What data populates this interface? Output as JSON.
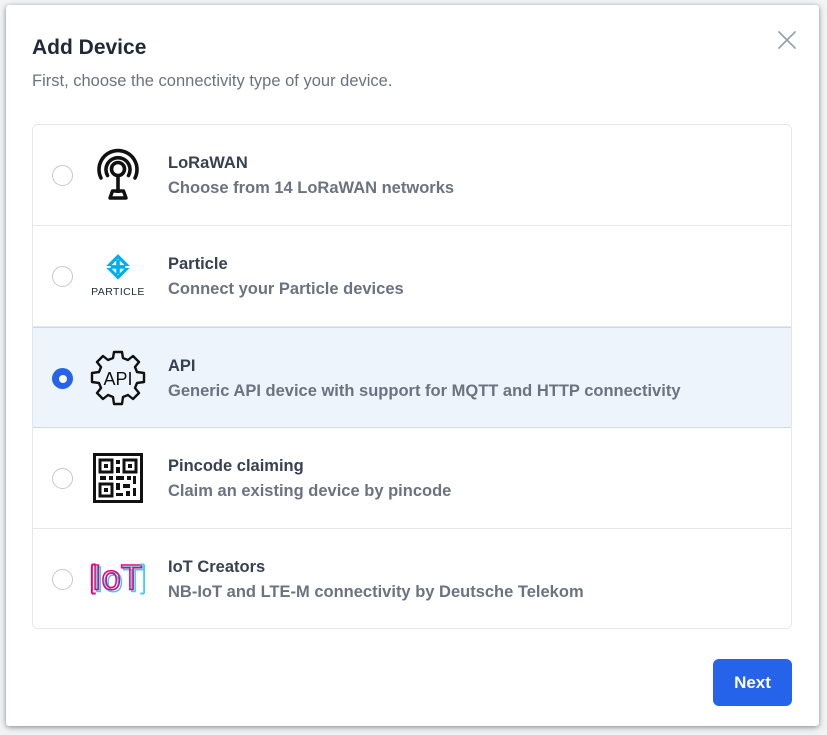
{
  "dialog": {
    "title": "Add Device",
    "subtitle": "First, choose the connectivity type of your device.",
    "next_label": "Next"
  },
  "colors": {
    "accent": "#2563eb",
    "selected_bg": "#eef4fc",
    "iot_pink": "#e6007e",
    "iot_cyan": "#3fd0e8",
    "particle_cyan": "#00aeef"
  },
  "options": [
    {
      "title": "LoRaWAN",
      "description": "Choose from 14 LoRaWAN networks",
      "icon": "antenna-icon",
      "selected": false
    },
    {
      "title": "Particle",
      "description": "Connect your Particle devices",
      "icon": "particle-logo",
      "logo_text": "PARTICLE",
      "selected": false
    },
    {
      "title": "API",
      "description": "Generic API device with support for MQTT and HTTP connectivity",
      "icon": "api-gear-icon",
      "icon_text": "API",
      "selected": true
    },
    {
      "title": "Pincode claiming",
      "description": "Claim an existing device by pincode",
      "icon": "qr-code-icon",
      "selected": false
    },
    {
      "title": "IoT Creators",
      "description": "NB-IoT and LTE-M connectivity by Deutsche Telekom",
      "icon": "iot-creators-logo",
      "logo_text": "IoT",
      "selected": false
    }
  ]
}
